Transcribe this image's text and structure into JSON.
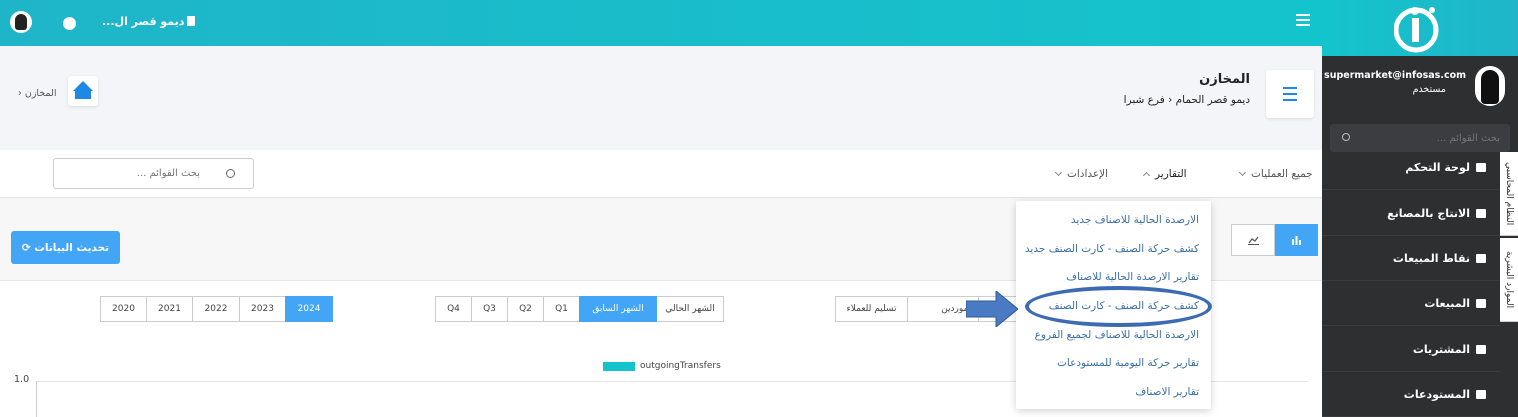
{
  "topbar": {
    "company_name": "ديمو قصر ال...",
    "colors": {
      "primary": "#14c4cc",
      "accent": "#42a5f5",
      "sidebar": "#2e2f31"
    }
  },
  "sidebar": {
    "user_email": "supermarket@infosas.com",
    "user_role": "مستخدم",
    "search_placeholder": "بحث القوائم ...",
    "items": [
      {
        "label": "لوحة التحكم",
        "icon": "dashboard-icon"
      },
      {
        "label": "الانتاج بالمصانع",
        "icon": "factory-icon"
      },
      {
        "label": "نقاط المبيعات",
        "icon": "pos-icon"
      },
      {
        "label": "المبيعات",
        "icon": "truck-icon"
      },
      {
        "label": "المشتريات",
        "icon": "purchase-icon"
      },
      {
        "label": "المستودعات",
        "icon": "warehouse-icon"
      }
    ],
    "vertical_tabs": [
      "النظام المحاسبي",
      "الموارد البشرية"
    ]
  },
  "header": {
    "title": "المخازن",
    "breadcrumb_company": "ديمو قصر الحمام",
    "breadcrumb_branch": "فرع شبرا",
    "right_crumb": "المخازن"
  },
  "nav": {
    "items": [
      "جميع العمليات",
      "التقارير",
      "الإعدادات"
    ],
    "search_placeholder": "بحث القوائم ..."
  },
  "content": {
    "refresh_label": "تحديث البيانات",
    "years": [
      "2020",
      "2021",
      "2022",
      "2023",
      "2024"
    ],
    "periods": [
      "Q4",
      "Q3",
      "Q2",
      "Q1",
      "الشهر السابق",
      "الشهر الحالي"
    ],
    "filters": [
      "تسليم للعملاء",
      "الموردين"
    ],
    "legend_label": "outgoingTransfers",
    "y_max_label": "1.0"
  },
  "reports_dropdown": {
    "items": [
      "الارصدة الحالية للاصناف جديد",
      "كشف حركة الصنف - كارت الصنف جديد",
      "تقارير الارصدة الحالية للاصناف",
      "كشف حركة الصنف - كارت الصنف",
      "الارصدة الحالية للاصناف لجميع الفروع",
      "تقارير حركة اليومية للمستودعات",
      "تقارير الاصناف"
    ]
  }
}
